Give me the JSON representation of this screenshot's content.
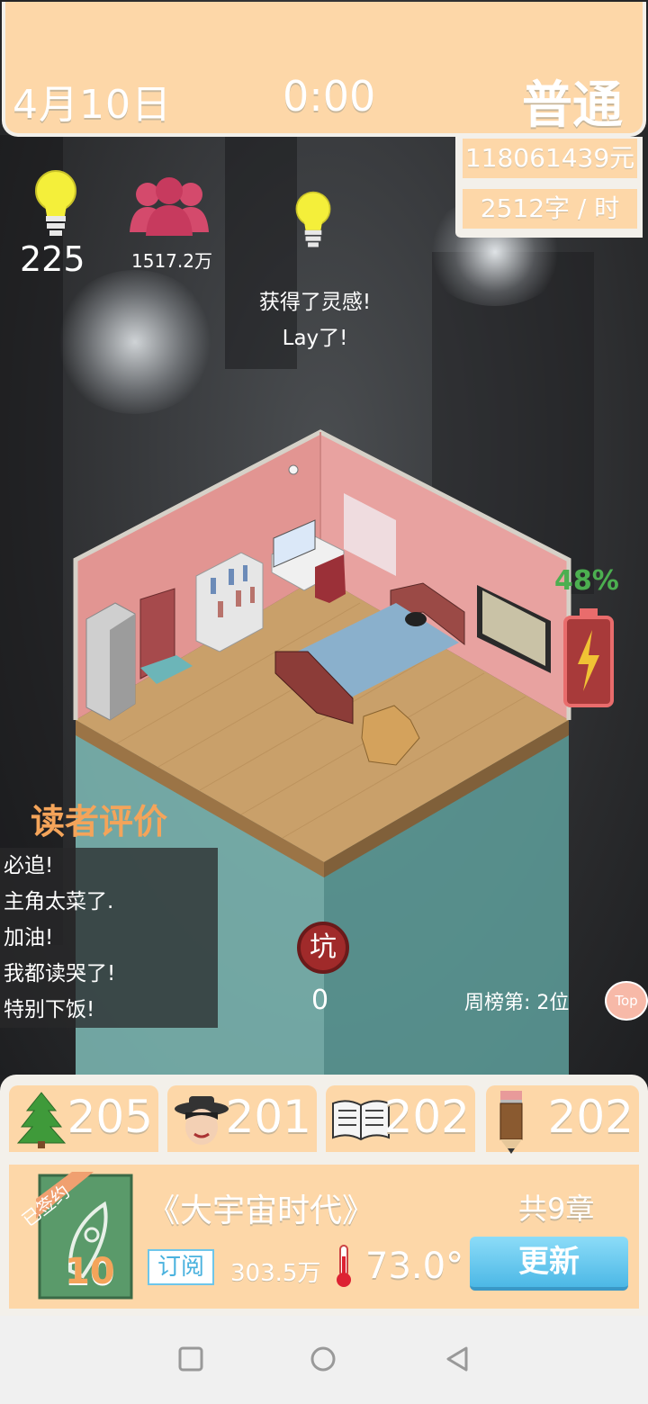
{
  "header": {
    "date": "4月10日",
    "time": "0:00",
    "difficulty": "普通"
  },
  "finance": {
    "money": "118061439元",
    "speed": "2512字 / 时"
  },
  "stats": {
    "inspiration": "225",
    "fans": "1517.2万"
  },
  "event": {
    "line1": "获得了灵感!",
    "line2": "Lay了!"
  },
  "battery": {
    "percent_label": "48%",
    "level": 0.48
  },
  "reviews": {
    "title": "读者评价",
    "items": [
      "必追!",
      "主角太菜了.",
      "加油!",
      "我都读哭了!",
      "特别下饭!"
    ]
  },
  "rank": {
    "text": "周榜第: 2位",
    "top_label": "Top"
  },
  "keng": {
    "label": "坑",
    "count": "0"
  },
  "resources": [
    {
      "icon": "tree-icon",
      "value": "205"
    },
    {
      "icon": "character-icon",
      "value": "201"
    },
    {
      "icon": "book-icon",
      "value": "202"
    },
    {
      "icon": "pencil-icon",
      "value": "202"
    }
  ],
  "book": {
    "ribbon": "已签约",
    "level": "10",
    "title": "《大宇宙时代》",
    "chapters": "共9章",
    "subscribe_label": "订阅",
    "subscribers": "303.5万",
    "heat": "73.0°",
    "update_label": "更新"
  }
}
